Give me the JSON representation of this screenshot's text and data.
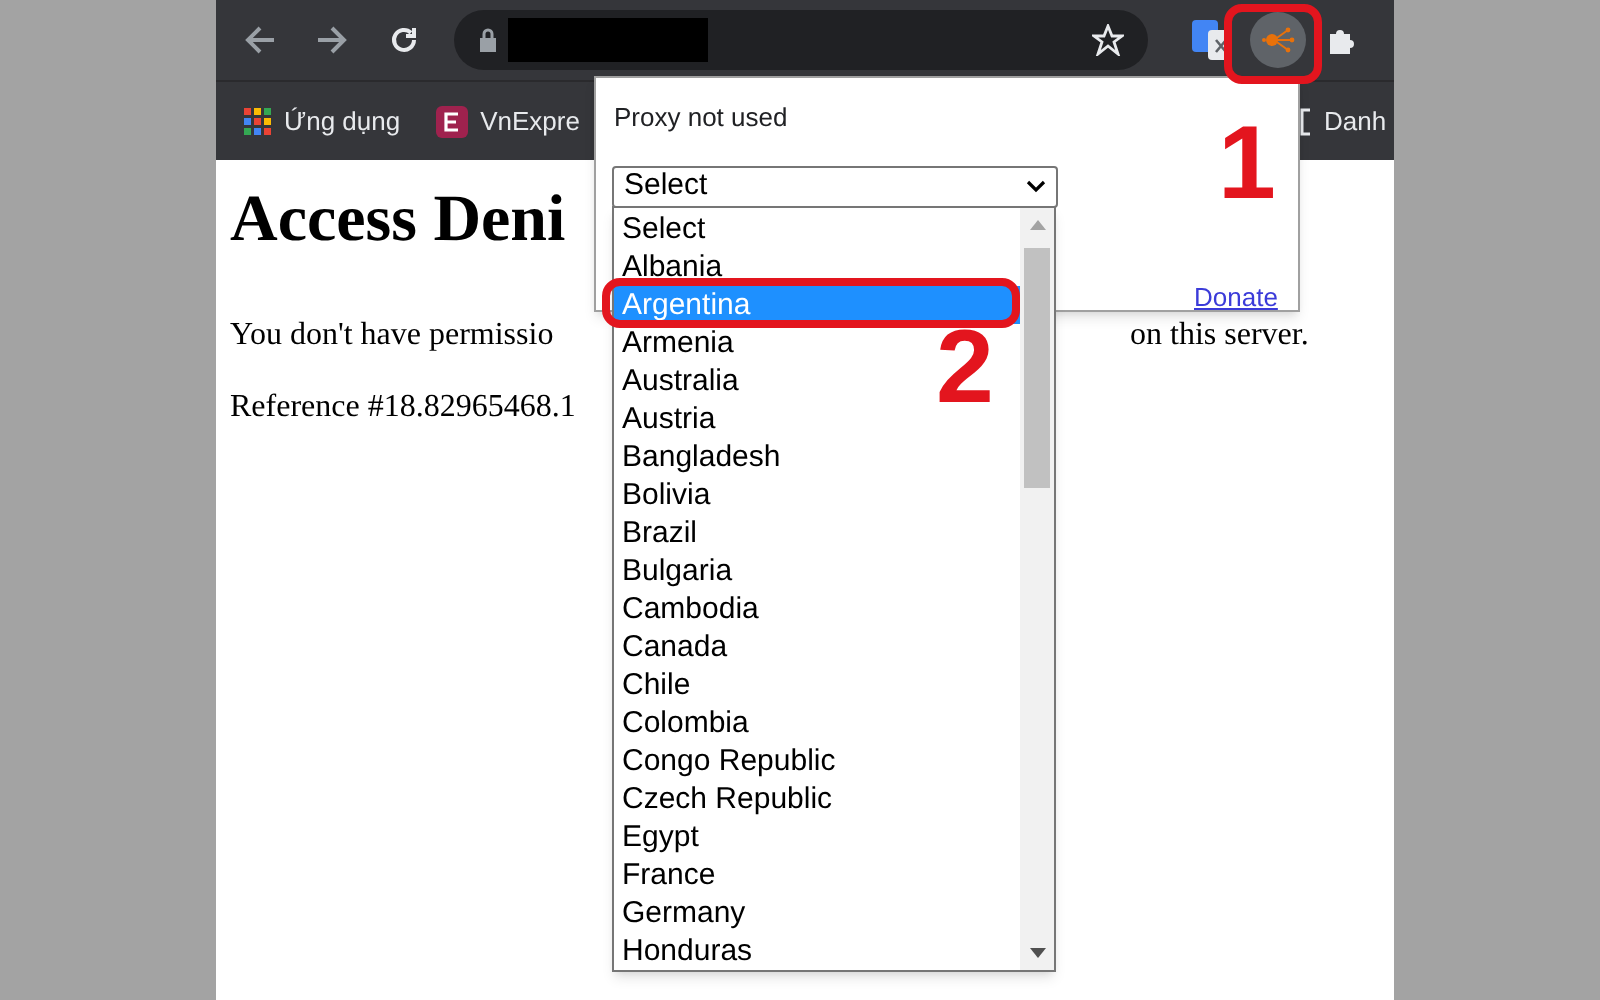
{
  "bookmarks": [
    {
      "kind": "apps",
      "label": "Ứng dụng"
    },
    {
      "kind": "site",
      "label": "VnExpre"
    },
    {
      "kind": "folder",
      "label": "Danh"
    }
  ],
  "page": {
    "heading": "Access Deni",
    "line_1": "You don't have permissio",
    "line_1_end": "on this server.",
    "reference": "Reference #18.82965468.1"
  },
  "popup": {
    "status": "Proxy not used",
    "select_value": "Select",
    "link": "Donate",
    "options": [
      {
        "label": "Select",
        "selected": false
      },
      {
        "label": "Albania",
        "selected": false
      },
      {
        "label": "Argentina",
        "selected": true
      },
      {
        "label": "Armenia",
        "selected": false
      },
      {
        "label": "Australia",
        "selected": false
      },
      {
        "label": "Austria",
        "selected": false
      },
      {
        "label": "Bangladesh",
        "selected": false
      },
      {
        "label": "Bolivia",
        "selected": false
      },
      {
        "label": "Brazil",
        "selected": false
      },
      {
        "label": "Bulgaria",
        "selected": false
      },
      {
        "label": "Cambodia",
        "selected": false
      },
      {
        "label": "Canada",
        "selected": false
      },
      {
        "label": "Chile",
        "selected": false
      },
      {
        "label": "Colombia",
        "selected": false
      },
      {
        "label": "Congo Republic",
        "selected": false
      },
      {
        "label": "Czech Republic",
        "selected": false
      },
      {
        "label": "Egypt",
        "selected": false
      },
      {
        "label": "France",
        "selected": false
      },
      {
        "label": "Germany",
        "selected": false
      },
      {
        "label": "Honduras",
        "selected": false
      }
    ]
  },
  "annotations": [
    {
      "label": "1"
    },
    {
      "label": "2"
    }
  ]
}
